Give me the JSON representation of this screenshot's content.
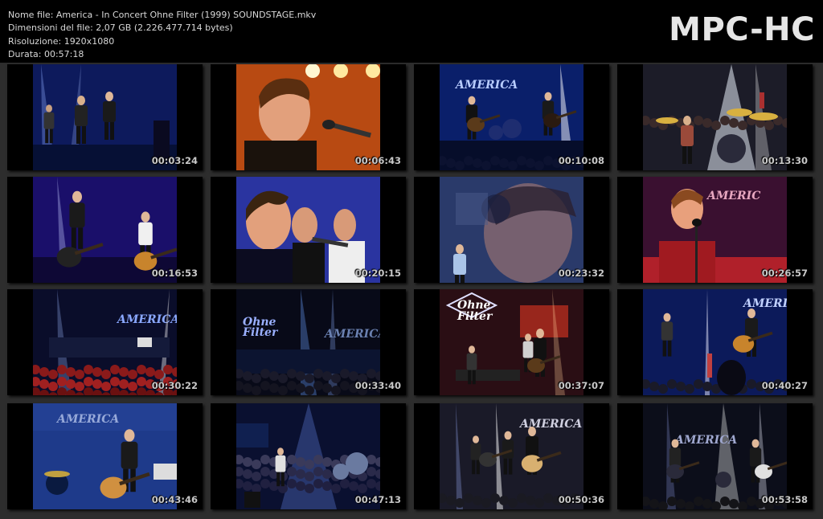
{
  "header": {
    "file_name": "Nome file: America - In Concert Ohne Filter (1999) SOUNDSTAGE.mkv",
    "file_size": "Dimensioni del file: 2,07 GB (2.226.477.714 bytes)",
    "resolution": "Risoluzione: 1920x1080",
    "duration": "Durata: 00:57:18"
  },
  "logo": "MPC-HC",
  "thumbnails": [
    {
      "time": "00:03:24",
      "scene": "stage-band-blue"
    },
    {
      "time": "00:06:43",
      "scene": "closeup-singer-orange"
    },
    {
      "time": "00:10:08",
      "scene": "stage-america-sign"
    },
    {
      "time": "00:13:30",
      "scene": "drummer-lights"
    },
    {
      "time": "00:16:53",
      "scene": "two-guitarists"
    },
    {
      "time": "00:20:15",
      "scene": "closeup-duo-blue"
    },
    {
      "time": "00:23:32",
      "scene": "overlay-closeup"
    },
    {
      "time": "00:26:57",
      "scene": "singer-red-sign"
    },
    {
      "time": "00:30:22",
      "scene": "wide-crowd-red"
    },
    {
      "time": "00:33:40",
      "scene": "wide-ohne-filter-dark"
    },
    {
      "time": "00:37:07",
      "scene": "ohne-filter-red-stage"
    },
    {
      "time": "00:40:27",
      "scene": "guitarists-america-sign"
    },
    {
      "time": "00:43:46",
      "scene": "guitarist-america-blue"
    },
    {
      "time": "00:47:13",
      "scene": "wide-crowd-blue"
    },
    {
      "time": "00:50:36",
      "scene": "stage-band-sign"
    },
    {
      "time": "00:53:58",
      "scene": "stage-band-spotlights"
    }
  ]
}
